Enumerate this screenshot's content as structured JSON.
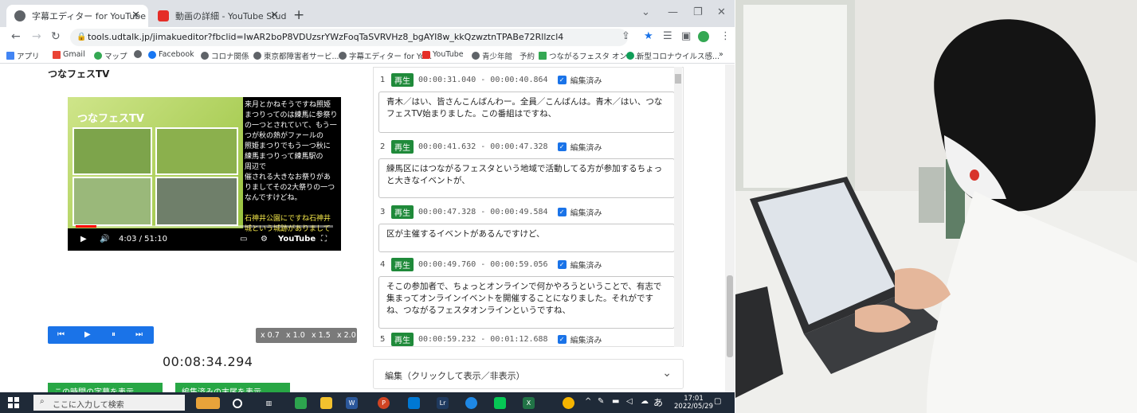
{
  "browser": {
    "tabs": [
      {
        "title": "字幕エディター for YouTube - UDトー",
        "active": true
      },
      {
        "title": "動画の詳細 - YouTube Studio",
        "active": false
      }
    ],
    "url": "tools.udtalk.jp/jimakueditor?fbclid=IwAR2boP8VDUzsrYWzFoqTaSVRVHz8_bgAYI8w_kkQzwztnTPABe72Rllzcl4",
    "bookmarks": [
      "アプリ",
      "Gmail",
      "マップ",
      "Facebook",
      "コロナ関係",
      "東京都障害者サービ...",
      "字幕エディター for Yo...",
      "YouTube",
      "青少年館",
      "予約",
      "つながるフェスタ オンラ...",
      "新型コロナウイルス感..."
    ]
  },
  "page": {
    "title": "つなフェスTV",
    "video": {
      "logo": "つなフェスTV",
      "subtitle_lines": [
        "来月とかねそうですね照姫",
        "まつりってのは練馬に参祭り",
        "の一つとされていて、もう一",
        "つが秋の熱がファールの",
        "照姫まつりでもう一つ秋に",
        "練馬まつりって練馬駅の",
        "周辺で",
        "",
        "催される大きなお祭りがあ",
        "りましてその2大祭りの一つ",
        "なんですけどね。"
      ],
      "subtitle_yellow": [
        "石神井公園にですね石神井",
        "城という城跡がありまして"
      ],
      "time": "4:03 / 51:10",
      "brand": "YouTube",
      "progress": 0.08
    },
    "speeds": [
      "x 0.7",
      "x 1.0",
      "x 1.5",
      "x 2.0"
    ],
    "timecode": "00:08:34.294",
    "buttons": {
      "show_now": "この時間の字幕を表示",
      "show_edited": "編集済みの末尾を表示"
    },
    "segments": [
      {
        "num": "1",
        "play": "再生",
        "time": "00:00:31.040 - 00:00:40.864",
        "status": "編集済み",
        "text": "青木／はい、皆さんこんばんわー。全員／こんばんは。青木／はい、つなフェスTV始まりました。この番組はですね、"
      },
      {
        "num": "2",
        "play": "再生",
        "time": "00:00:41.632 - 00:00:47.328",
        "status": "編集済み",
        "text": "練馬区にはつながるフェスタという地域で活動してる方が参加するちょっと大きなイベントが、"
      },
      {
        "num": "3",
        "play": "再生",
        "time": "00:00:47.328 - 00:00:49.584",
        "status": "編集済み",
        "text": "区が主催するイベントがあるんですけど、"
      },
      {
        "num": "4",
        "play": "再生",
        "time": "00:00:49.760 - 00:00:59.056",
        "status": "編集済み",
        "text": "そこの参加者で、ちょっとオンラインで何かやろうということで、有志で集まってオンラインイベントを開催することになりました。それがですね、つながるフェスタオンラインというですね、"
      },
      {
        "num": "5",
        "play": "再生",
        "time": "00:00:59.232 - 00:01:12.688",
        "status": "編集済み",
        "text": ""
      }
    ],
    "accordion": "編集（クリックして表示／非表示）"
  },
  "taskbar": {
    "search_placeholder": "ここに入力して検索",
    "ime": "あ",
    "time": "17:01",
    "date": "2022/05/29"
  },
  "photo": {
    "description_icon": "person-with-laptop"
  }
}
